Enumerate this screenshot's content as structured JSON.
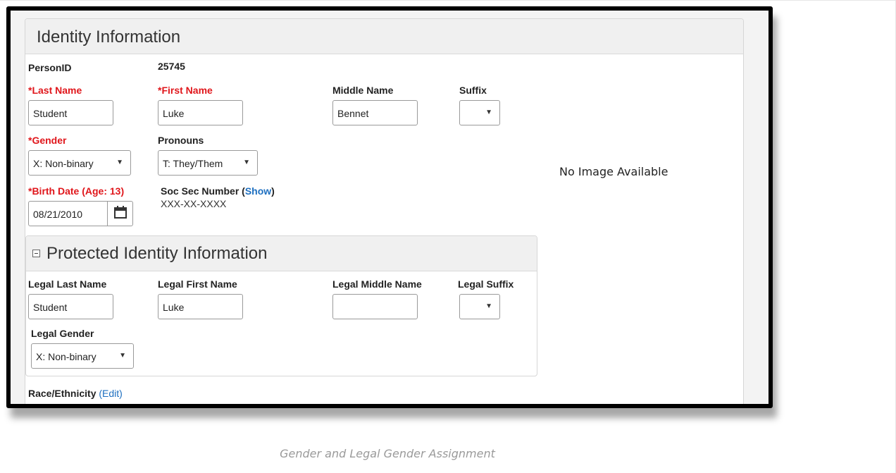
{
  "panel_title": "Identity Information",
  "person_id": {
    "label": "PersonID",
    "value": "25745"
  },
  "name_fields": {
    "last_name": {
      "label": "*Last Name",
      "value": "Student"
    },
    "first_name": {
      "label": "*First Name",
      "value": "Luke"
    },
    "middle_name": {
      "label": "Middle Name",
      "value": "Bennet"
    },
    "suffix": {
      "label": "Suffix",
      "value": ""
    }
  },
  "gender": {
    "label": "*Gender",
    "value": "X: Non-binary"
  },
  "pronouns": {
    "label": "Pronouns",
    "value": "T: They/Them"
  },
  "birth_date": {
    "label": "*Birth Date (Age: 13)",
    "value": "08/21/2010"
  },
  "ssn": {
    "label": "Soc Sec Number (",
    "show_link": "Show",
    "label_close": ")",
    "value": "XXX-XX-XXXX"
  },
  "photo": {
    "text": "No Image Available"
  },
  "protected": {
    "title": "Protected Identity Information",
    "legal_last_name": {
      "label": "Legal Last Name",
      "value": "Student"
    },
    "legal_first_name": {
      "label": "Legal First Name",
      "value": "Luke"
    },
    "legal_middle_name": {
      "label": "Legal Middle Name",
      "value": ""
    },
    "legal_suffix": {
      "label": "Legal Suffix",
      "value": ""
    },
    "legal_gender": {
      "label": "Legal Gender",
      "value": "X: Non-binary"
    }
  },
  "race_ethnicity": {
    "label": "Race/Ethnicity",
    "edit_open": "(",
    "edit_link": "Edit",
    "edit_close": ")"
  },
  "caption": "Gender and Legal Gender Assignment",
  "colors": {
    "required": "#e0161b",
    "link": "#1d6fc0"
  }
}
